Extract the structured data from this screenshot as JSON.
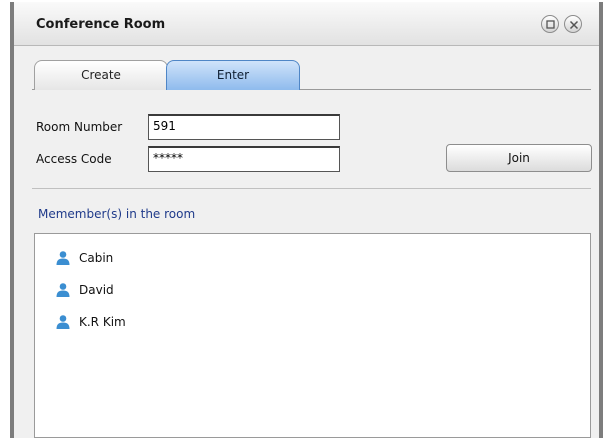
{
  "window": {
    "title": "Conference Room"
  },
  "tabs": [
    {
      "label": "Create",
      "active": false
    },
    {
      "label": "Enter",
      "active": true
    }
  ],
  "form": {
    "room_number_label": "Room Number",
    "room_number_value": "591",
    "access_code_label": "Access Code",
    "access_code_value": "*****",
    "join_label": "Join"
  },
  "members": {
    "label": "Memember(s) in the room",
    "list": [
      {
        "name": "Cabin",
        "icon": "user-icon"
      },
      {
        "name": "David",
        "icon": "user-icon"
      },
      {
        "name": "K.R Kim",
        "icon": "user-icon"
      }
    ]
  },
  "colors": {
    "active_tab": "#8fbbed",
    "member_label": "#1f3a8a",
    "user_icon": "#3b8ed1"
  }
}
